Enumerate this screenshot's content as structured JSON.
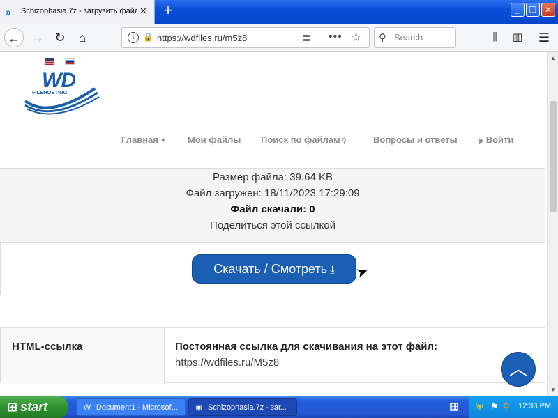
{
  "browser": {
    "tab_title": "Schizophasia.7z - загрузить файл",
    "tab_close": "✕",
    "new_tab": "+",
    "window_buttons": {
      "minimize": "_",
      "maximize": "❐",
      "close": "✕"
    },
    "url": "https://wdfiles.ru/m5z8",
    "search_placeholder": "Search",
    "icons": {
      "back": "arrow-left-icon",
      "forward": "arrow-right-icon",
      "reload": "reload-icon",
      "home": "home-icon",
      "info": "info-icon",
      "lock": "lock-icon",
      "reader": "reader-view-icon",
      "more": "more-dots-icon",
      "star": "bookmark-star-icon",
      "library": "library-icon",
      "sidebar": "sidebar-icon",
      "menu": "hamburger-menu-icon"
    }
  },
  "site": {
    "logo_text": "WD",
    "logo_sub": "FILEHOSTING",
    "languages": [
      "en",
      "ru"
    ],
    "nav": {
      "home": "Главная",
      "my_files": "Мои файлы",
      "search": "Поиск по файлам",
      "faq": "Вопросы и ответы",
      "login": "Войти"
    }
  },
  "file_info": {
    "size": "Размер файла: 39.64 KB",
    "uploaded": "Файл загружен: 18/11/2023 17:29:09",
    "downloads": "Файл скачали: 0",
    "share": "Поделиться этой ссылкой"
  },
  "download_button": "Скачать / Смотреть",
  "link_table": {
    "html_label": "HTML-ссылка",
    "permanent_label": "Постоянная ссылка для скачивания на этот файл:",
    "permanent_url": "https://wdfiles.ru/M5z8"
  },
  "taskbar": {
    "start": "start",
    "items": [
      {
        "label": "Document1 - Microsof...",
        "icon": "word-icon"
      },
      {
        "label": "Schizophasia.7z - заг...",
        "icon": "firefox-icon"
      }
    ],
    "clock": "12:33 PM"
  },
  "colors": {
    "accent": "#1a5fb4",
    "nav_text": "#8e8e8e",
    "xp_blue": "#245edb",
    "start_green": "#2f8f2f"
  }
}
